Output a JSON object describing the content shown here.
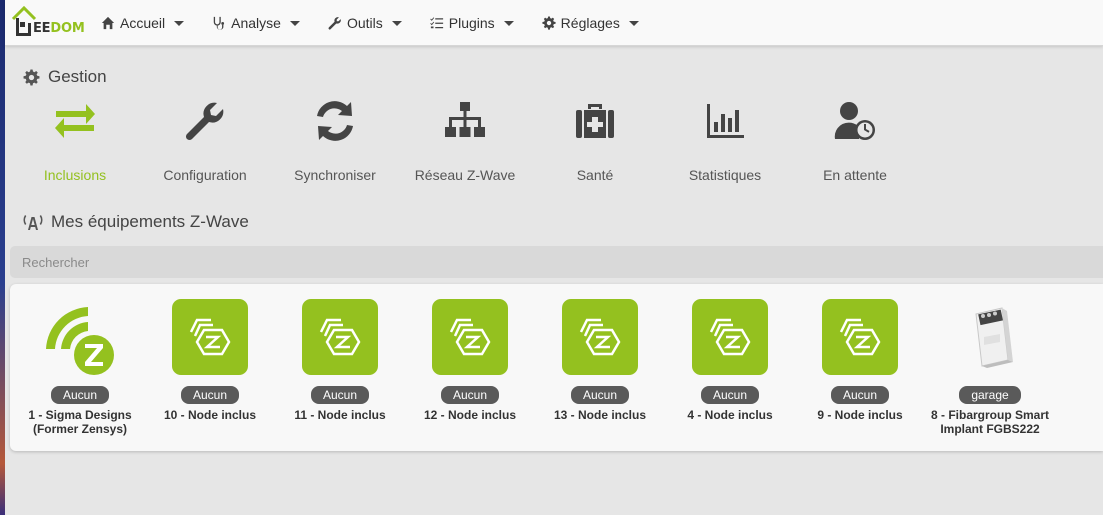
{
  "brand": {
    "part1": "EE",
    "part2": "DOM"
  },
  "nav": [
    {
      "label": "Accueil",
      "icon": "home-icon"
    },
    {
      "label": "Analyse",
      "icon": "stethoscope-icon"
    },
    {
      "label": "Outils",
      "icon": "wrench-icon"
    },
    {
      "label": "Plugins",
      "icon": "tasks-icon"
    },
    {
      "label": "Réglages",
      "icon": "cog-icon"
    }
  ],
  "gestion": {
    "title": "Gestion",
    "items": [
      {
        "label": "Inclusions",
        "icon": "exchange-arrows-icon",
        "active": true
      },
      {
        "label": "Configuration",
        "icon": "wrench-icon"
      },
      {
        "label": "Synchroniser",
        "icon": "sync-icon"
      },
      {
        "label": "Réseau Z-Wave",
        "icon": "network-tree-icon"
      },
      {
        "label": "Santé",
        "icon": "medkit-icon"
      },
      {
        "label": "Statistiques",
        "icon": "bar-chart-icon"
      },
      {
        "label": "En attente",
        "icon": "user-clock-icon"
      }
    ]
  },
  "equipements": {
    "title": "Mes équipements Z-Wave",
    "search_placeholder": "Rechercher",
    "devices": [
      {
        "badge": "Aucun",
        "name": "1 - Sigma Designs (Former Zensys)",
        "image": "zwave-signal-logo"
      },
      {
        "badge": "Aucun",
        "name": "10 - Node inclus",
        "image": "zwave-green-tile"
      },
      {
        "badge": "Aucun",
        "name": "11 - Node inclus",
        "image": "zwave-green-tile"
      },
      {
        "badge": "Aucun",
        "name": "12 - Node inclus",
        "image": "zwave-green-tile"
      },
      {
        "badge": "Aucun",
        "name": "13 - Node inclus",
        "image": "zwave-green-tile"
      },
      {
        "badge": "Aucun",
        "name": "4 - Node inclus",
        "image": "zwave-green-tile"
      },
      {
        "badge": "Aucun",
        "name": "9 - Node inclus",
        "image": "zwave-green-tile"
      },
      {
        "badge": "garage",
        "name": "8 - Fibargroup Smart Implant FGBS222",
        "image": "fibaro-implant-module"
      }
    ]
  },
  "colors": {
    "accent": "#94c11f",
    "badge": "#5a5a5a",
    "text": "#444444"
  }
}
